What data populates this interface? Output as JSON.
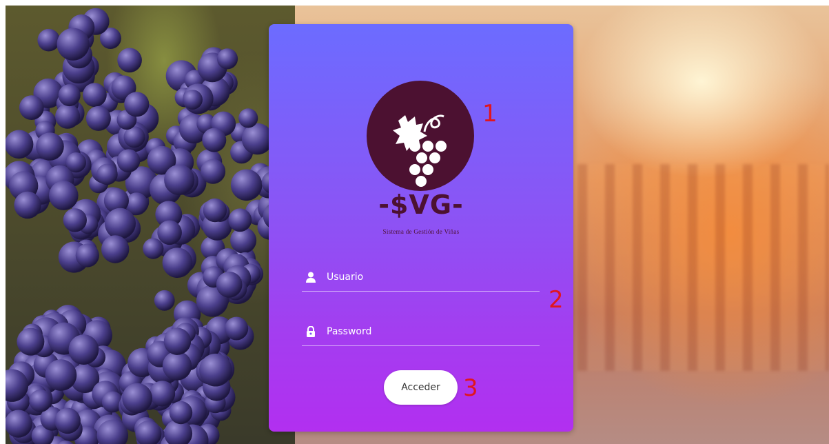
{
  "annotations": [
    "1",
    "2",
    "3"
  ],
  "brand": {
    "title": "-$VG-",
    "subtitle": "Sistema de Gestión de Viñas",
    "logo_color": "#4c1131"
  },
  "form": {
    "username_placeholder": "Usuario",
    "password_placeholder": "Password",
    "submit_label": "Acceder"
  },
  "colors": {
    "card_top": "#6c6cff",
    "card_bottom": "#b22ff0",
    "annotation": "#e0161e"
  },
  "icons": {
    "user": "user-icon",
    "password": "lock-icon",
    "logo": "grape-icon"
  }
}
